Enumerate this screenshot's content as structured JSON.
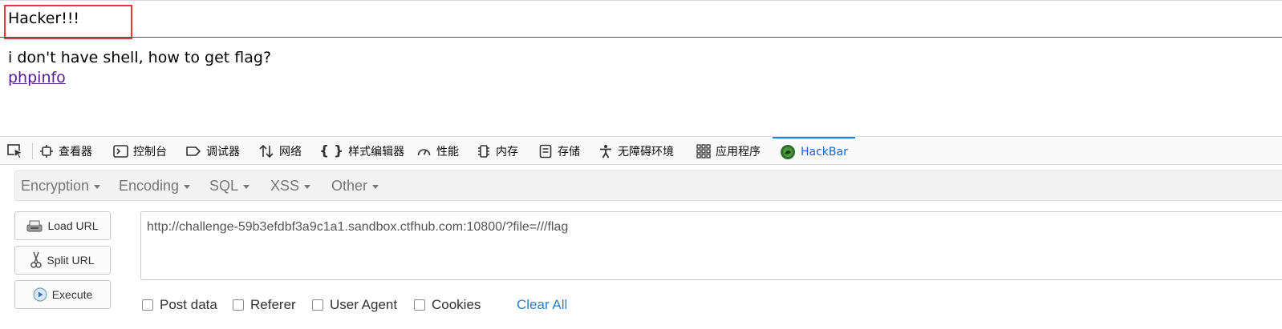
{
  "page": {
    "alert_text": "Hacker!!!",
    "message": "i don't have shell, how to get flag?",
    "link_text": "phpinfo"
  },
  "devtools": {
    "tabs": [
      {
        "label": "查看器",
        "icon": "inspector-icon"
      },
      {
        "label": "控制台",
        "icon": "console-icon"
      },
      {
        "label": "调试器",
        "icon": "debugger-icon"
      },
      {
        "label": "网络",
        "icon": "network-icon"
      },
      {
        "label": "样式编辑器",
        "icon": "style-editor-icon"
      },
      {
        "label": "性能",
        "icon": "performance-icon"
      },
      {
        "label": "内存",
        "icon": "memory-icon"
      },
      {
        "label": "存储",
        "icon": "storage-icon"
      },
      {
        "label": "无障碍环境",
        "icon": "accessibility-icon"
      },
      {
        "label": "应用程序",
        "icon": "application-icon"
      },
      {
        "label": "HackBar",
        "icon": "hackbar-icon"
      }
    ],
    "active_tab": "HackBar",
    "accent_color": "#0a84ff"
  },
  "hackbar": {
    "menu": [
      "Encryption",
      "Encoding",
      "SQL",
      "XSS",
      "Other"
    ],
    "buttons": {
      "load_url": "Load URL",
      "split_url": "Split URL",
      "execute": "Execute"
    },
    "url": "http://challenge-59b3efdbf3a9c1a1.sandbox.ctfhub.com:10800/?file=///flag",
    "options": {
      "post_data": "Post data",
      "referer": "Referer",
      "user_agent": "User Agent",
      "cookies": "Cookies"
    },
    "clear_all": "Clear All"
  }
}
